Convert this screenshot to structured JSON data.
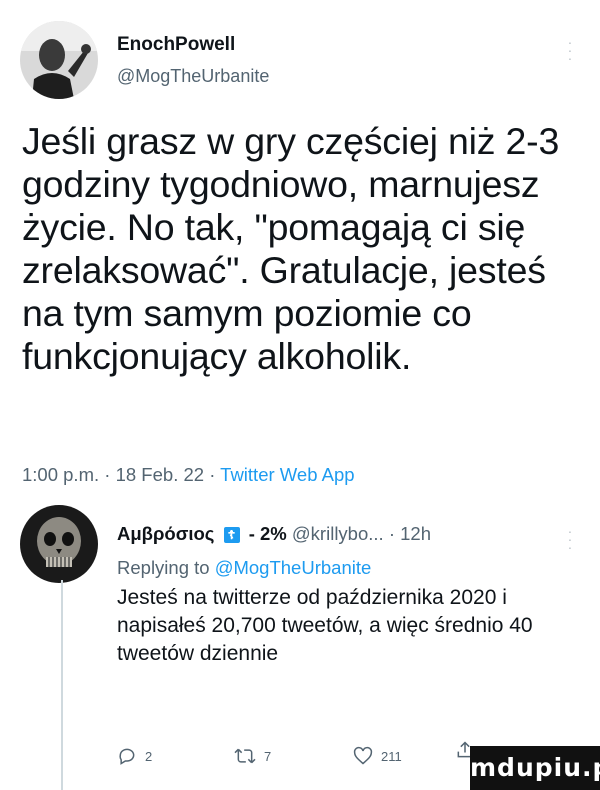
{
  "tweet": {
    "author_name": "EnochPowell",
    "author_handle": "@MogTheUrbanite",
    "text": "Jeśli grasz w gry częściej niż 2-3 godziny tygodniowo, marnujesz życie. No tak, \"pomagają ci się zrelaksować\". Gratulacje, jesteś na tym samym poziomie co funkcjonujący alkoholik.",
    "time": "1:00 p.m.",
    "date": "18 Feb. 22",
    "via": "Twitter Web App",
    "separator": "·"
  },
  "reply": {
    "author_name": "Αμβρόσιος",
    "cross_icon": "☦",
    "percent": "- 2%",
    "author_handle": "@krillybo...",
    "age": "12h",
    "separator": "·",
    "replying_prefix": "Replying to",
    "replying_to": "@MogTheUrbanite",
    "text": "Jesteś na twitterze od października 2020 i napisałeś 20,700 tweetów, a więc średnio 40 tweetów dziennie",
    "actions": {
      "replies": "2",
      "retweets": "7",
      "likes": "211"
    }
  },
  "watermark": "mdupiu.pl",
  "icons": [
    "avatar-photo",
    "menu-dots-icon",
    "reply-icon",
    "retweet-icon",
    "like-icon",
    "share-icon"
  ],
  "colors": {
    "text": "#0f1419",
    "secondary": "#536471",
    "link": "#1d9bf0"
  }
}
